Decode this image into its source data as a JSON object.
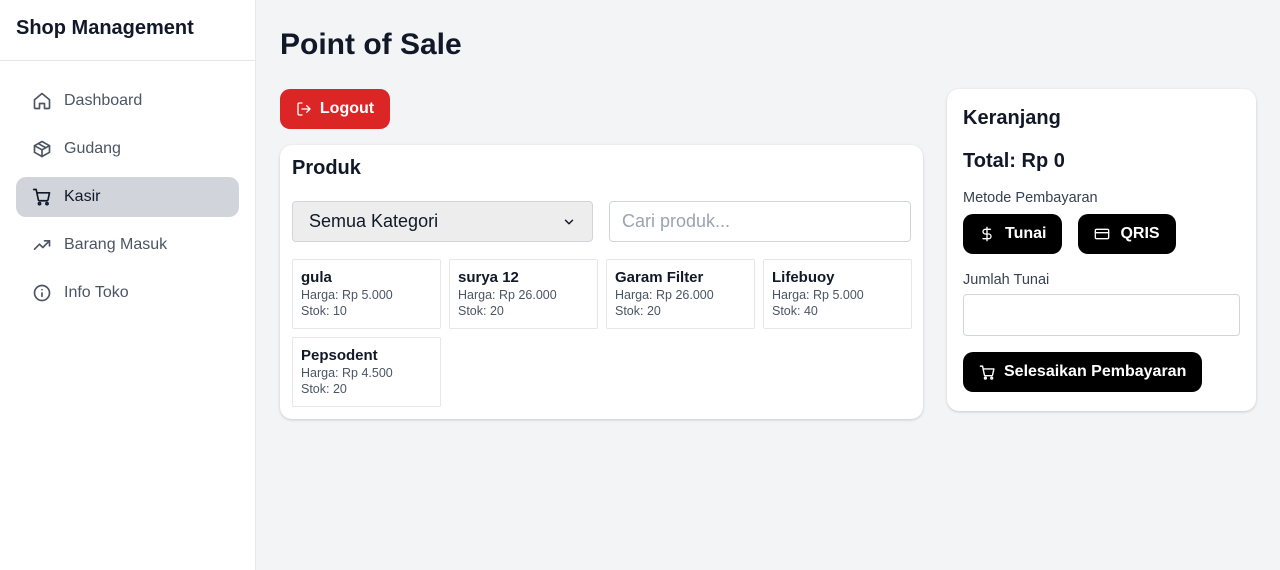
{
  "app": {
    "brand": "Shop Management"
  },
  "sidebar": {
    "items": [
      {
        "label": "Dashboard",
        "icon": "home-icon",
        "active": false
      },
      {
        "label": "Gudang",
        "icon": "package-icon",
        "active": false
      },
      {
        "label": "Kasir",
        "icon": "shopping-cart-icon",
        "active": true
      },
      {
        "label": "Barang Masuk",
        "icon": "trending-up-icon",
        "active": false
      },
      {
        "label": "Info Toko",
        "icon": "info-icon",
        "active": false
      }
    ]
  },
  "header": {
    "title": "Point of Sale",
    "logout_label": "Logout"
  },
  "products": {
    "title": "Produk",
    "category_selected": "Semua Kategori",
    "search_placeholder": "Cari produk...",
    "items": [
      {
        "name": "gula",
        "price": "Harga: Rp 5.000",
        "stock": "Stok: 10"
      },
      {
        "name": "surya 12",
        "price": "Harga: Rp 26.000",
        "stock": "Stok: 20"
      },
      {
        "name": "Garam Filter",
        "price": "Harga: Rp 26.000",
        "stock": "Stok: 20"
      },
      {
        "name": "Lifebuoy",
        "price": "Harga: Rp 5.000",
        "stock": "Stok: 40"
      },
      {
        "name": "Pepsodent",
        "price": "Harga: Rp 4.500",
        "stock": "Stok: 20"
      }
    ]
  },
  "cart": {
    "title": "Keranjang",
    "total": "Total: Rp 0",
    "payment_method_label": "Metode Pembayaran",
    "payment_methods": [
      {
        "label": "Tunai",
        "icon": "dollar-icon"
      },
      {
        "label": "QRIS",
        "icon": "credit-card-icon"
      }
    ],
    "cash_amount_label": "Jumlah Tunai",
    "cash_amount_value": "",
    "finish_label": "Selesaikan Pembayaran"
  },
  "colors": {
    "logout": "#dc2626",
    "primary_button": "#000000",
    "active_nav": "#d1d5db",
    "background": "#f3f4f6"
  }
}
